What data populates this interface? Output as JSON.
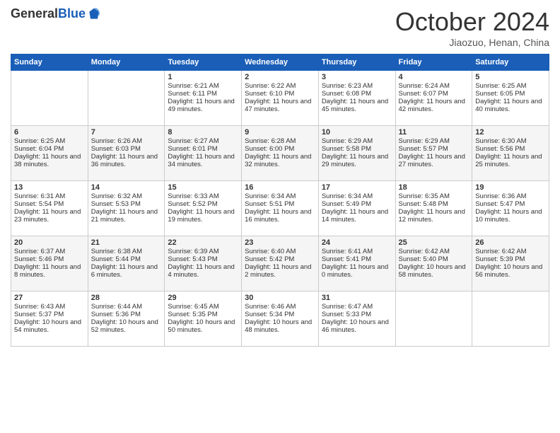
{
  "logo": {
    "general": "General",
    "blue": "Blue"
  },
  "header": {
    "title": "October 2024",
    "location": "Jiaozuo, Henan, China"
  },
  "days_of_week": [
    "Sunday",
    "Monday",
    "Tuesday",
    "Wednesday",
    "Thursday",
    "Friday",
    "Saturday"
  ],
  "weeks": [
    [
      {
        "day": "",
        "sunrise": "",
        "sunset": "",
        "daylight": ""
      },
      {
        "day": "",
        "sunrise": "",
        "sunset": "",
        "daylight": ""
      },
      {
        "day": "1",
        "sunrise": "Sunrise: 6:21 AM",
        "sunset": "Sunset: 6:11 PM",
        "daylight": "Daylight: 11 hours and 49 minutes."
      },
      {
        "day": "2",
        "sunrise": "Sunrise: 6:22 AM",
        "sunset": "Sunset: 6:10 PM",
        "daylight": "Daylight: 11 hours and 47 minutes."
      },
      {
        "day": "3",
        "sunrise": "Sunrise: 6:23 AM",
        "sunset": "Sunset: 6:08 PM",
        "daylight": "Daylight: 11 hours and 45 minutes."
      },
      {
        "day": "4",
        "sunrise": "Sunrise: 6:24 AM",
        "sunset": "Sunset: 6:07 PM",
        "daylight": "Daylight: 11 hours and 42 minutes."
      },
      {
        "day": "5",
        "sunrise": "Sunrise: 6:25 AM",
        "sunset": "Sunset: 6:05 PM",
        "daylight": "Daylight: 11 hours and 40 minutes."
      }
    ],
    [
      {
        "day": "6",
        "sunrise": "Sunrise: 6:25 AM",
        "sunset": "Sunset: 6:04 PM",
        "daylight": "Daylight: 11 hours and 38 minutes."
      },
      {
        "day": "7",
        "sunrise": "Sunrise: 6:26 AM",
        "sunset": "Sunset: 6:03 PM",
        "daylight": "Daylight: 11 hours and 36 minutes."
      },
      {
        "day": "8",
        "sunrise": "Sunrise: 6:27 AM",
        "sunset": "Sunset: 6:01 PM",
        "daylight": "Daylight: 11 hours and 34 minutes."
      },
      {
        "day": "9",
        "sunrise": "Sunrise: 6:28 AM",
        "sunset": "Sunset: 6:00 PM",
        "daylight": "Daylight: 11 hours and 32 minutes."
      },
      {
        "day": "10",
        "sunrise": "Sunrise: 6:29 AM",
        "sunset": "Sunset: 5:58 PM",
        "daylight": "Daylight: 11 hours and 29 minutes."
      },
      {
        "day": "11",
        "sunrise": "Sunrise: 6:29 AM",
        "sunset": "Sunset: 5:57 PM",
        "daylight": "Daylight: 11 hours and 27 minutes."
      },
      {
        "day": "12",
        "sunrise": "Sunrise: 6:30 AM",
        "sunset": "Sunset: 5:56 PM",
        "daylight": "Daylight: 11 hours and 25 minutes."
      }
    ],
    [
      {
        "day": "13",
        "sunrise": "Sunrise: 6:31 AM",
        "sunset": "Sunset: 5:54 PM",
        "daylight": "Daylight: 11 hours and 23 minutes."
      },
      {
        "day": "14",
        "sunrise": "Sunrise: 6:32 AM",
        "sunset": "Sunset: 5:53 PM",
        "daylight": "Daylight: 11 hours and 21 minutes."
      },
      {
        "day": "15",
        "sunrise": "Sunrise: 6:33 AM",
        "sunset": "Sunset: 5:52 PM",
        "daylight": "Daylight: 11 hours and 19 minutes."
      },
      {
        "day": "16",
        "sunrise": "Sunrise: 6:34 AM",
        "sunset": "Sunset: 5:51 PM",
        "daylight": "Daylight: 11 hours and 16 minutes."
      },
      {
        "day": "17",
        "sunrise": "Sunrise: 6:34 AM",
        "sunset": "Sunset: 5:49 PM",
        "daylight": "Daylight: 11 hours and 14 minutes."
      },
      {
        "day": "18",
        "sunrise": "Sunrise: 6:35 AM",
        "sunset": "Sunset: 5:48 PM",
        "daylight": "Daylight: 11 hours and 12 minutes."
      },
      {
        "day": "19",
        "sunrise": "Sunrise: 6:36 AM",
        "sunset": "Sunset: 5:47 PM",
        "daylight": "Daylight: 11 hours and 10 minutes."
      }
    ],
    [
      {
        "day": "20",
        "sunrise": "Sunrise: 6:37 AM",
        "sunset": "Sunset: 5:46 PM",
        "daylight": "Daylight: 11 hours and 8 minutes."
      },
      {
        "day": "21",
        "sunrise": "Sunrise: 6:38 AM",
        "sunset": "Sunset: 5:44 PM",
        "daylight": "Daylight: 11 hours and 6 minutes."
      },
      {
        "day": "22",
        "sunrise": "Sunrise: 6:39 AM",
        "sunset": "Sunset: 5:43 PM",
        "daylight": "Daylight: 11 hours and 4 minutes."
      },
      {
        "day": "23",
        "sunrise": "Sunrise: 6:40 AM",
        "sunset": "Sunset: 5:42 PM",
        "daylight": "Daylight: 11 hours and 2 minutes."
      },
      {
        "day": "24",
        "sunrise": "Sunrise: 6:41 AM",
        "sunset": "Sunset: 5:41 PM",
        "daylight": "Daylight: 11 hours and 0 minutes."
      },
      {
        "day": "25",
        "sunrise": "Sunrise: 6:42 AM",
        "sunset": "Sunset: 5:40 PM",
        "daylight": "Daylight: 10 hours and 58 minutes."
      },
      {
        "day": "26",
        "sunrise": "Sunrise: 6:42 AM",
        "sunset": "Sunset: 5:39 PM",
        "daylight": "Daylight: 10 hours and 56 minutes."
      }
    ],
    [
      {
        "day": "27",
        "sunrise": "Sunrise: 6:43 AM",
        "sunset": "Sunset: 5:37 PM",
        "daylight": "Daylight: 10 hours and 54 minutes."
      },
      {
        "day": "28",
        "sunrise": "Sunrise: 6:44 AM",
        "sunset": "Sunset: 5:36 PM",
        "daylight": "Daylight: 10 hours and 52 minutes."
      },
      {
        "day": "29",
        "sunrise": "Sunrise: 6:45 AM",
        "sunset": "Sunset: 5:35 PM",
        "daylight": "Daylight: 10 hours and 50 minutes."
      },
      {
        "day": "30",
        "sunrise": "Sunrise: 6:46 AM",
        "sunset": "Sunset: 5:34 PM",
        "daylight": "Daylight: 10 hours and 48 minutes."
      },
      {
        "day": "31",
        "sunrise": "Sunrise: 6:47 AM",
        "sunset": "Sunset: 5:33 PM",
        "daylight": "Daylight: 10 hours and 46 minutes."
      },
      {
        "day": "",
        "sunrise": "",
        "sunset": "",
        "daylight": ""
      },
      {
        "day": "",
        "sunrise": "",
        "sunset": "",
        "daylight": ""
      }
    ]
  ]
}
